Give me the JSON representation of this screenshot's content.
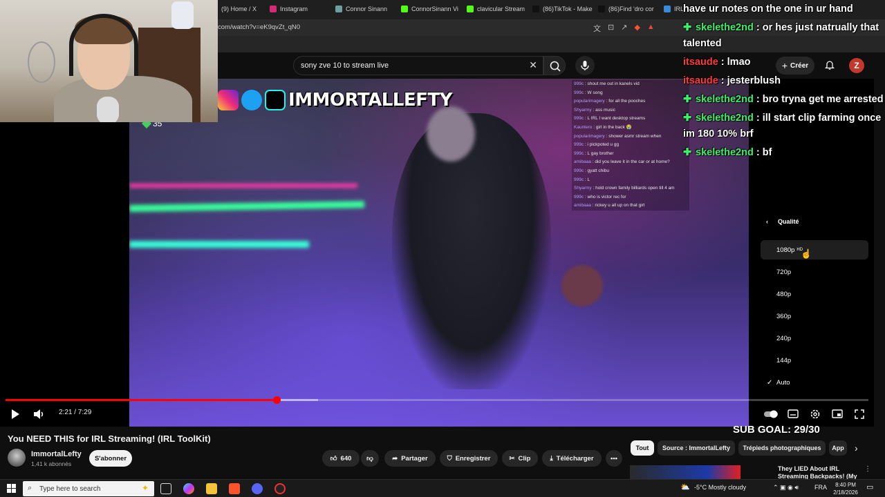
{
  "browser": {
    "tabs": [
      {
        "label": "(9) Home / X",
        "color": "#444444"
      },
      {
        "label": "Instagram",
        "color": "#d62976"
      },
      {
        "label": "Connor Sinann",
        "color": "#6aa0a0"
      },
      {
        "label": "ConnorSinann Vi",
        "color": "#53fc18"
      },
      {
        "label": "clavicular Stream",
        "color": "#53fc18"
      },
      {
        "label": "(86)TikTok - Make",
        "color": "#111111"
      },
      {
        "label": "(86)Find 'dro cor",
        "color": "#111111"
      },
      {
        "label": "IRLTo",
        "color": "#3a8ad8"
      }
    ],
    "url": "com/watch?v=eK9qvZt_qN0"
  },
  "youtube": {
    "search_value": "sony zve 10 to stream live",
    "create_label": "Créer",
    "avatar_letter": "Z"
  },
  "stream_overlay": {
    "watermark": "IMMORTALLEFTY",
    "viewer_count": "35",
    "overlay_chat": [
      {
        "user": "999c",
        "msg": "shout me out in kanels vid"
      },
      {
        "user": "999c",
        "msg": "W song"
      },
      {
        "user": "popularimagery",
        "msg": "for all the pooches"
      },
      {
        "user": "Shyarmy",
        "msg": "ass music"
      },
      {
        "user": "999c",
        "msg": "L IRL I want desktop streams"
      },
      {
        "user": "Kauntero",
        "msg": "girl in the back 😭"
      },
      {
        "user": "popularimagery",
        "msg": "shower asmr stream when"
      },
      {
        "user": "999c",
        "msg": "i pickpoted u gg"
      },
      {
        "user": "999c",
        "msg": "L gay brother"
      },
      {
        "user": "amibaaa",
        "msg": "did you leave it in the car or at home?"
      },
      {
        "user": "999c",
        "msg": "gyatt chibu"
      },
      {
        "user": "999c",
        "msg": "L"
      },
      {
        "user": "Shyarmy",
        "msg": "hold crown family billiards open till 4 am"
      },
      {
        "user": "999c",
        "msg": "who is victor rec for"
      },
      {
        "user": "amibaaa",
        "msg": "rickey u all up on that girl"
      }
    ],
    "twitch_chat": [
      {
        "user": "",
        "msg": "have ur notes on the one in ur hand",
        "user_color": "green",
        "badge": false
      },
      {
        "user": "skelethe2nd",
        "msg": "or hes just natrually that talented",
        "user_color": "green",
        "badge": true
      },
      {
        "user": "itsaude",
        "msg": "lmao",
        "user_color": "red",
        "badge": false
      },
      {
        "user": "itsaude",
        "msg": "jesterblush",
        "user_color": "red",
        "badge": false
      },
      {
        "user": "skelethe2nd",
        "msg": "bro tryna get me arrested",
        "user_color": "green",
        "badge": true
      },
      {
        "user": "skelethe2nd",
        "msg": "ill start clip farming once im 180 10% brf",
        "user_color": "green",
        "badge": true
      },
      {
        "user": "skelethe2nd",
        "msg": "bf",
        "user_color": "green",
        "badge": true
      }
    ],
    "sub_goal": "SUB GOAL: 29/30"
  },
  "player": {
    "time": "2:21 / 7:29",
    "progress": 0.314,
    "buffered": 0.3624,
    "quality_menu": {
      "title": "Qualité",
      "options": [
        {
          "label": "1080p",
          "badge": "HD",
          "selected": false,
          "hover": true
        },
        {
          "label": "720p",
          "badge": "",
          "selected": false,
          "hover": false
        },
        {
          "label": "480p",
          "badge": "",
          "selected": false,
          "hover": false
        },
        {
          "label": "360p",
          "badge": "",
          "selected": false,
          "hover": false
        },
        {
          "label": "240p",
          "badge": "",
          "selected": false,
          "hover": false
        },
        {
          "label": "144p",
          "badge": "",
          "selected": false,
          "hover": false
        },
        {
          "label": "Auto",
          "badge": "",
          "selected": true,
          "hover": false
        }
      ]
    }
  },
  "video": {
    "title": "You NEED THIS for IRL Streaming! (IRL ToolKit)",
    "channel": "ImmortalLefty",
    "subscribers": "1,41 k abonnés",
    "subscribe_label": "S'abonner",
    "likes": "640",
    "share_label": "Partager",
    "save_label": "Enregistrer",
    "clip_label": "Clip",
    "download_label": "Télécharger"
  },
  "chips": [
    {
      "label": "Tout",
      "active": true
    },
    {
      "label": "Source : ImmortalLefty",
      "active": false
    },
    {
      "label": "Trépieds photographiques",
      "active": false
    },
    {
      "label": "App",
      "active": false
    }
  ],
  "recommendation": {
    "title": "They LIED About IRL Streaming Backpacks! (My"
  },
  "taskbar": {
    "search_placeholder": "Type here to search",
    "weather": "-5°C  Mostly cloudy",
    "language": "FRA",
    "time": "8:40 PM",
    "date": "2/18/2026"
  }
}
